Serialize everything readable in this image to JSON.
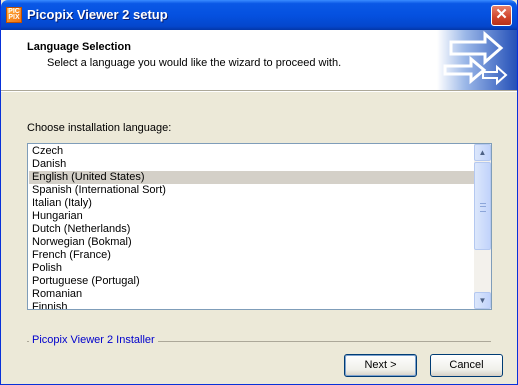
{
  "window": {
    "title": "Picopix Viewer 2 setup",
    "icon_name": "picopix-app-icon",
    "icon_text": "PIC PIX"
  },
  "header": {
    "title": "Language Selection",
    "subtitle": "Select a language you would like the wizard to proceed with.",
    "graphic": "arrows-graphic"
  },
  "main": {
    "choose_label": "Choose installation language:",
    "languages": [
      "Czech",
      "Danish",
      "English (United States)",
      "Spanish (International Sort)",
      "Italian (Italy)",
      "Hungarian",
      "Dutch (Netherlands)",
      "Norwegian (Bokmal)",
      "French (France)",
      "Polish",
      "Portuguese (Portugal)",
      "Romanian",
      "Finnish"
    ],
    "selected": "English (United States)"
  },
  "footer": {
    "installer_label": "Picopix Viewer 2 Installer",
    "next_label": "Next >",
    "cancel_label": "Cancel"
  },
  "colors": {
    "title_bar": "#0551E0",
    "selection": "#D4D0C8",
    "installer_text": "#0000CC",
    "dialog_bg": "#ECE9D8"
  }
}
